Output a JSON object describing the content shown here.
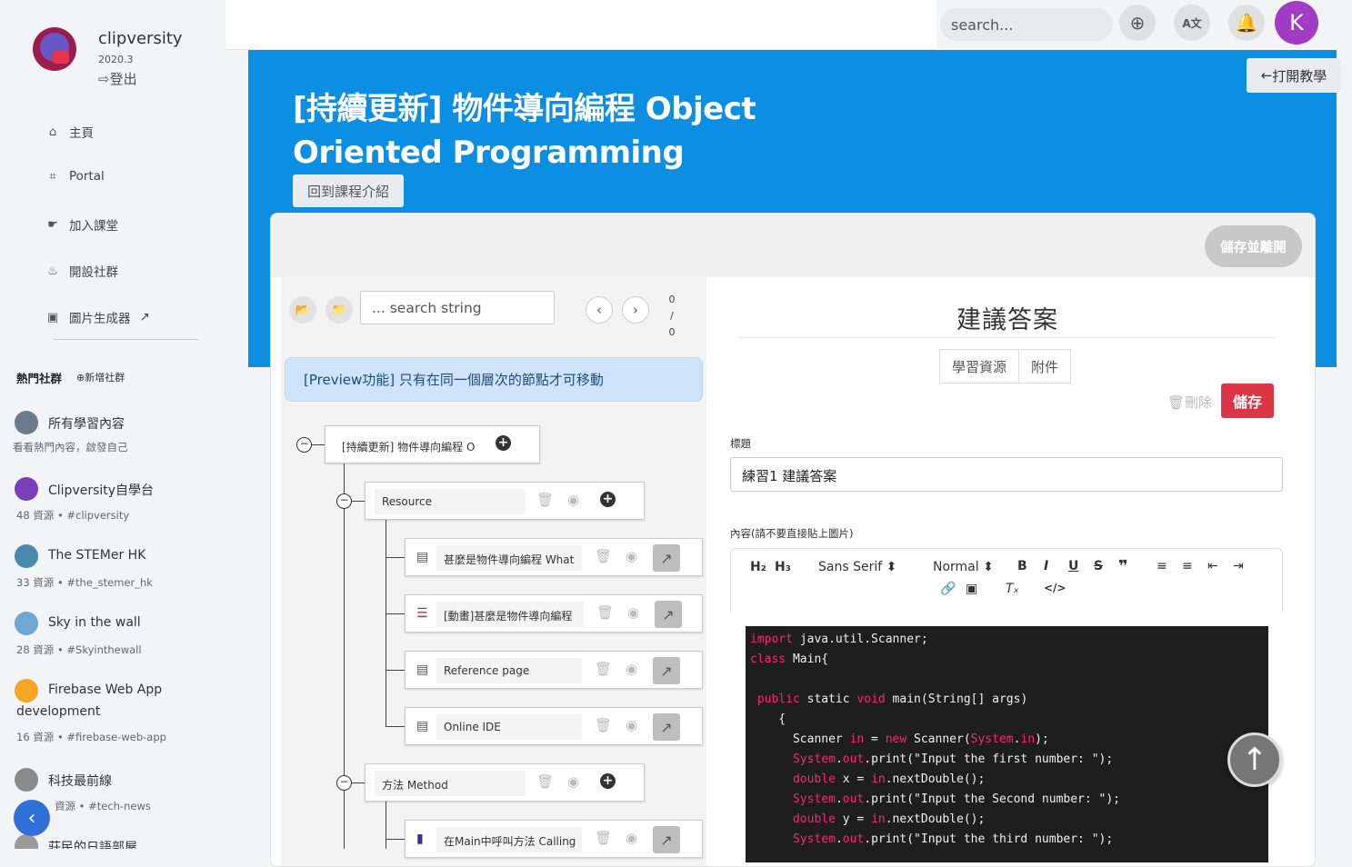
{
  "app": {
    "name": "clipversity",
    "version": "2020.3",
    "logout": "登出"
  },
  "nav": [
    {
      "label": "主頁",
      "icon": "home-icon"
    },
    {
      "label": "Portal",
      "icon": "portal-icon"
    },
    {
      "label": "加入課堂",
      "icon": "join-icon"
    },
    {
      "label": "開設社群",
      "icon": "create-community-icon"
    },
    {
      "label": "圖片生成器",
      "icon": "image-generator-icon"
    }
  ],
  "hot": {
    "title": "熱門社群",
    "add": "新增社群",
    "items": [
      {
        "name": "所有學習內容",
        "meta": "看看熱門內容，啟發自己",
        "color": "#6b7a8c"
      },
      {
        "name": "Clipversity自學台",
        "meta": "48 資源 • #clipversity",
        "color": "#7a3fb4"
      },
      {
        "name": "The STEMer HK",
        "meta": "33 資源 • #the_stemer_hk",
        "color": "#4a8ab0"
      },
      {
        "name": "Sky in the wall",
        "meta": "28 資源 • #Skyinthewall",
        "color": "#6fa7d4"
      },
      {
        "name": "Firebase Web App",
        "name2": "development",
        "meta": "16 資源 • #firebase-web-app",
        "color": "#f5a623"
      },
      {
        "name": "科技最前線",
        "meta": "資源 • #tech-news",
        "color": "#8a8a8a"
      },
      {
        "name": "莊民的日語部屋",
        "meta": "",
        "color": "#9a9a9a"
      }
    ]
  },
  "topbar": {
    "search_placeholder": "search...",
    "avatar_letter": "K"
  },
  "hero": {
    "title": "[持續更新] 物件導向編程 Object Oriented Programming",
    "back": "回到課程介紹",
    "tutorial": "打開教學"
  },
  "card": {
    "save_leave": "儲存並離開"
  },
  "tree": {
    "search_placeholder": "... search string",
    "count": [
      "0",
      "/",
      "0"
    ],
    "preview": "[Preview功能] 只有在同一個層次的節點才可移動",
    "root": "[持續更新] 物件導向編程 O",
    "resource": "Resource",
    "items": [
      "甚麼是物件導向編程 What",
      "[動畫]甚麼是物件導向編程",
      "Reference page",
      "Online IDE"
    ],
    "method": "方法 Method",
    "method_item": "在Main中呼叫方法 Calling"
  },
  "editor": {
    "title": "建議答案",
    "tabs": [
      "學習資源",
      "附件"
    ],
    "delete": "刪除",
    "save": "儲存",
    "title_label": "標題",
    "title_value": "練習1 建議答案",
    "content_label": "內容(請不要直接貼上圖片)",
    "font": "Sans Serif",
    "size": "Normal"
  }
}
